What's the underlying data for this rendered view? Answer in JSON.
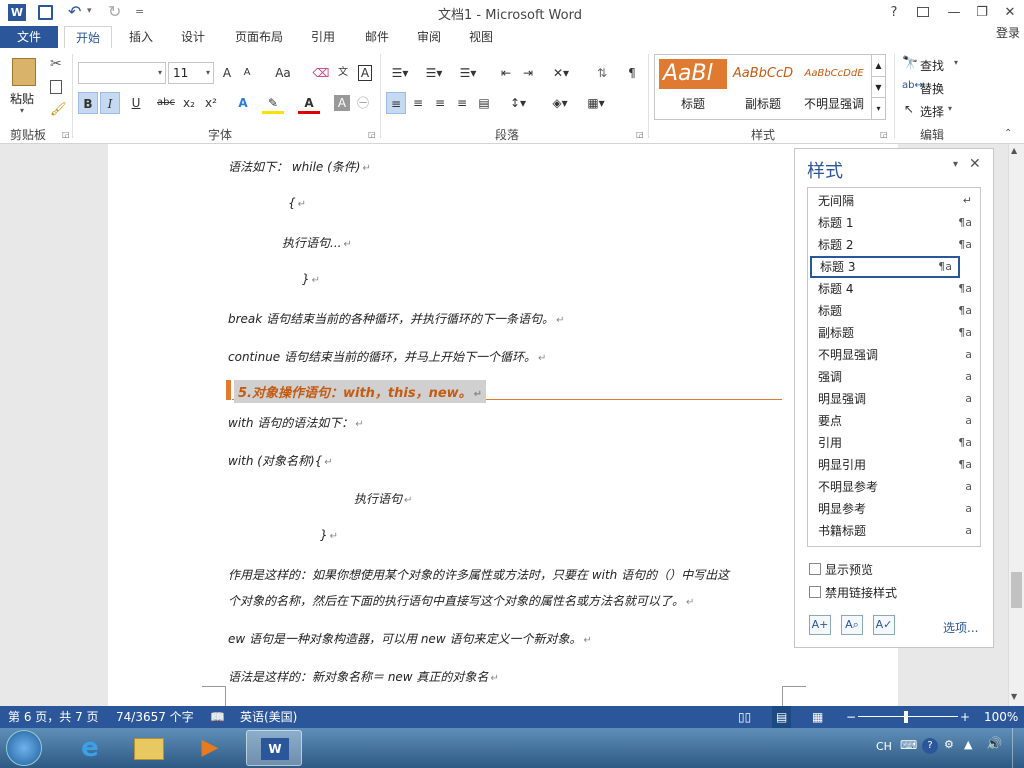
{
  "title": {
    "doc_title": "文档1 - Microsoft Word",
    "help": "?",
    "login": "登录",
    "undo_arrow": "▾",
    "customize": "="
  },
  "tabs": [
    "文件",
    "开始",
    "插入",
    "设计",
    "页面布局",
    "引用",
    "邮件",
    "审阅",
    "视图"
  ],
  "ribbon": {
    "clipboard": {
      "paste": "粘贴",
      "label": "剪贴板"
    },
    "font": {
      "name": "",
      "size": "11",
      "grow": "A",
      "shrink": "A",
      "case": "Aa",
      "bold": "B",
      "italic": "I",
      "underline": "U",
      "strike": "abc",
      "sub": "x₂",
      "sup": "x²",
      "label": "字体"
    },
    "paragraph": {
      "label": "段落"
    },
    "styles": {
      "gallery": [
        {
          "sample": "AaBl",
          "name": "标题"
        },
        {
          "sample": "AaBbCcD",
          "name": "副标题"
        },
        {
          "sample": "AaBbCcDdE",
          "name": "不明显强调"
        }
      ],
      "label": "样式"
    },
    "editing": {
      "find": "查找",
      "replace": "替换",
      "select": "选择",
      "label": "编辑"
    }
  },
  "doc": {
    "lines": [
      "语法如下：  while (条件)",
      "{",
      "执行语句...",
      "}",
      "break 语句结束当前的各种循环，并执行循环的下一条语句。",
      "continue 语句结束当前的循环，并马上开始下一个循环。",
      "5.对象操作语句：with，this，new。",
      "with 语句的语法如下：",
      "with (对象名称){",
      "执行语句",
      "}",
      "作用是这样的：如果你想使用某个对象的许多属性或方法时，只要在 with 语句的（）中写出这",
      "个对象的名称，然后在下面的执行语句中直接写这个对象的属性名或方法名就可以了。",
      "ew 语句是一种对象构造器，可以用 new 语句来定义一个新对象。",
      "语法是这样的：新对象名称＝ new  真正的对象名"
    ]
  },
  "styles_pane": {
    "title": "样式",
    "items": [
      {
        "name": "无间隔",
        "mark": "↵"
      },
      {
        "name": "标题 1",
        "mark": "¶a"
      },
      {
        "name": "标题 2",
        "mark": "¶a"
      },
      {
        "name": "标题 3",
        "mark": "¶a"
      },
      {
        "name": "标题 4",
        "mark": "¶a"
      },
      {
        "name": "标题",
        "mark": "¶a"
      },
      {
        "name": "副标题",
        "mark": "¶a"
      },
      {
        "name": "不明显强调",
        "mark": "a"
      },
      {
        "name": "强调",
        "mark": "a"
      },
      {
        "name": "明显强调",
        "mark": "a"
      },
      {
        "name": "要点",
        "mark": "a"
      },
      {
        "name": "引用",
        "mark": "¶a"
      },
      {
        "name": "明显引用",
        "mark": "¶a"
      },
      {
        "name": "不明显参考",
        "mark": "a"
      },
      {
        "name": "明显参考",
        "mark": "a"
      },
      {
        "name": "书籍标题",
        "mark": "a"
      }
    ],
    "selected_index": 3,
    "show_preview": "显示预览",
    "disable_linked": "禁用链接样式",
    "options": "选项..."
  },
  "status": {
    "page": "第 6 页，共 7 页",
    "words": "74/3657 个字",
    "lang": "英语(美国)",
    "zoom": "100%"
  },
  "taskbar": {
    "ime": "CH"
  },
  "colors": {
    "accent": "#2b579a",
    "heading": "#c55a11"
  }
}
